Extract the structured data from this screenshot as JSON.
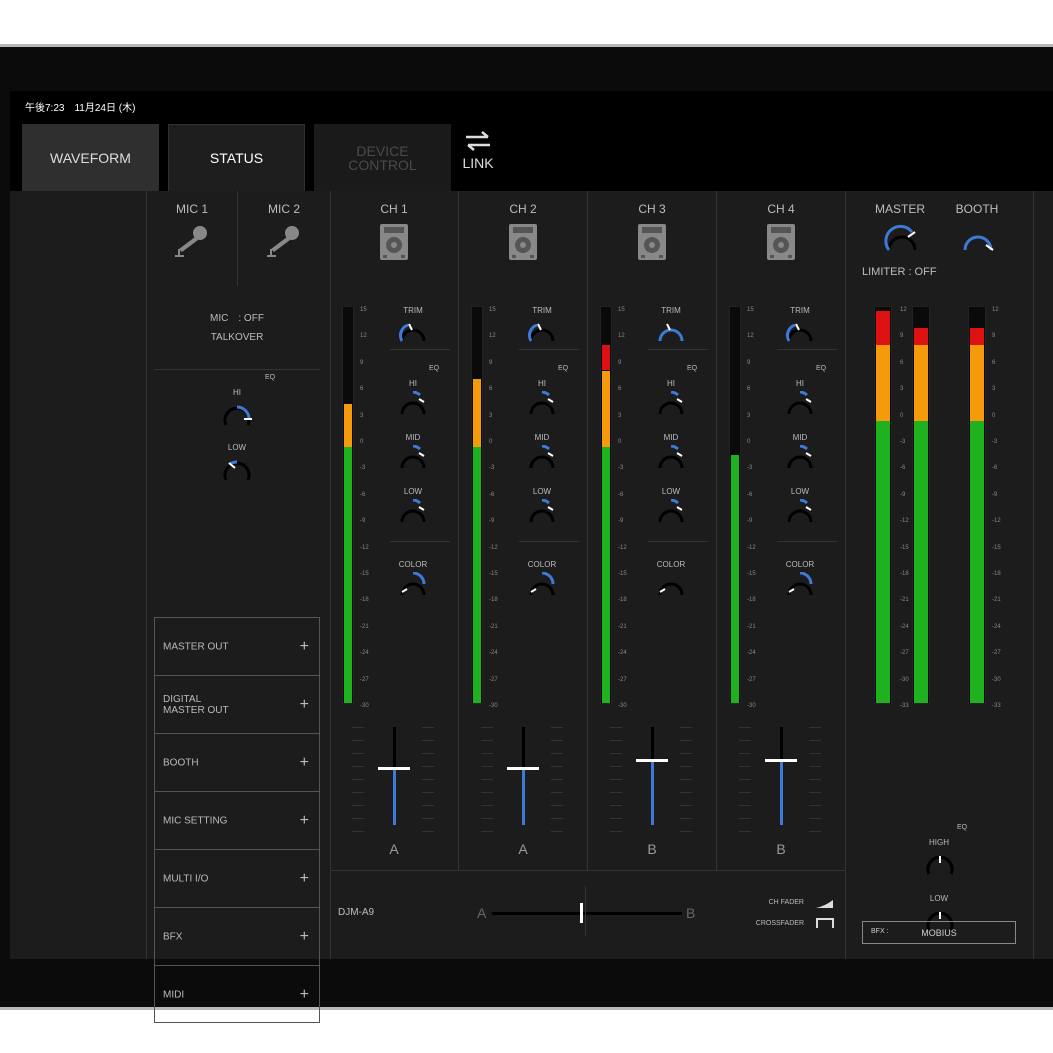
{
  "status_bar": {
    "clock": "午後7:23　11月24日 (木)"
  },
  "tabs": [
    {
      "label": "WAVEFORM"
    },
    {
      "label": "STATUS"
    },
    {
      "label_line1": "DEVICE",
      "label_line2": "CONTROL"
    }
  ],
  "link": {
    "label": "LINK"
  },
  "mic": {
    "mic1": "MIC 1",
    "mic2": "MIC 2",
    "status": "MIC　: OFF",
    "talkover": "TALKOVER",
    "eq": "EQ",
    "hi": "HI",
    "low": "LOW"
  },
  "menu": [
    {
      "label": "MASTER OUT"
    },
    {
      "label": "DIGITAL\nMASTER OUT"
    },
    {
      "label": "BOOTH"
    },
    {
      "label": "MIC SETTING"
    },
    {
      "label": "MULTI I/O"
    },
    {
      "label": "BFX"
    },
    {
      "label": "MIDI"
    }
  ],
  "channels": [
    {
      "name": "CH 1",
      "assign": "A",
      "level_db": 5,
      "fader": 0.58
    },
    {
      "name": "CH 2",
      "assign": "A",
      "level_db": 8,
      "fader": 0.58
    },
    {
      "name": "CH 3",
      "assign": "B",
      "level_db": 12,
      "fader": 0.66
    },
    {
      "name": "CH 4",
      "assign": "B",
      "level_db": -1,
      "fader": 0.66
    }
  ],
  "channel_knobs": {
    "trim": "TRIM",
    "eq": "EQ",
    "hi": "HI",
    "mid": "MID",
    "low": "LOW",
    "color": "COLOR"
  },
  "meter_scale": [
    "15",
    "12",
    "9",
    "6",
    "3",
    "0",
    "-3",
    "-6",
    "-9",
    "-12",
    "-15",
    "-18",
    "-21",
    "-24",
    "-27",
    "-30"
  ],
  "master_scale": [
    "12",
    "9",
    "6",
    "3",
    "0",
    "-3",
    "-6",
    "-9",
    "-12",
    "-15",
    "-18",
    "-21",
    "-24",
    "-27",
    "-30",
    "-33"
  ],
  "master": {
    "label": "MASTER",
    "booth": "BOOTH",
    "limiter": "LIMITER : OFF",
    "eq": "EQ",
    "high": "HIGH",
    "low": "LOW",
    "bfx_label": "BFX :",
    "bfx_value": "MOBIUS"
  },
  "crossfader": {
    "model": "DJM-A9",
    "a": "A",
    "b": "B",
    "ch_fader": "CH FADER",
    "crossfader": "CROSSFADER"
  },
  "colors": {
    "green": "#1fb21f",
    "orange": "#f59a0a",
    "red": "#d11",
    "knob": "#3d7ad8"
  }
}
